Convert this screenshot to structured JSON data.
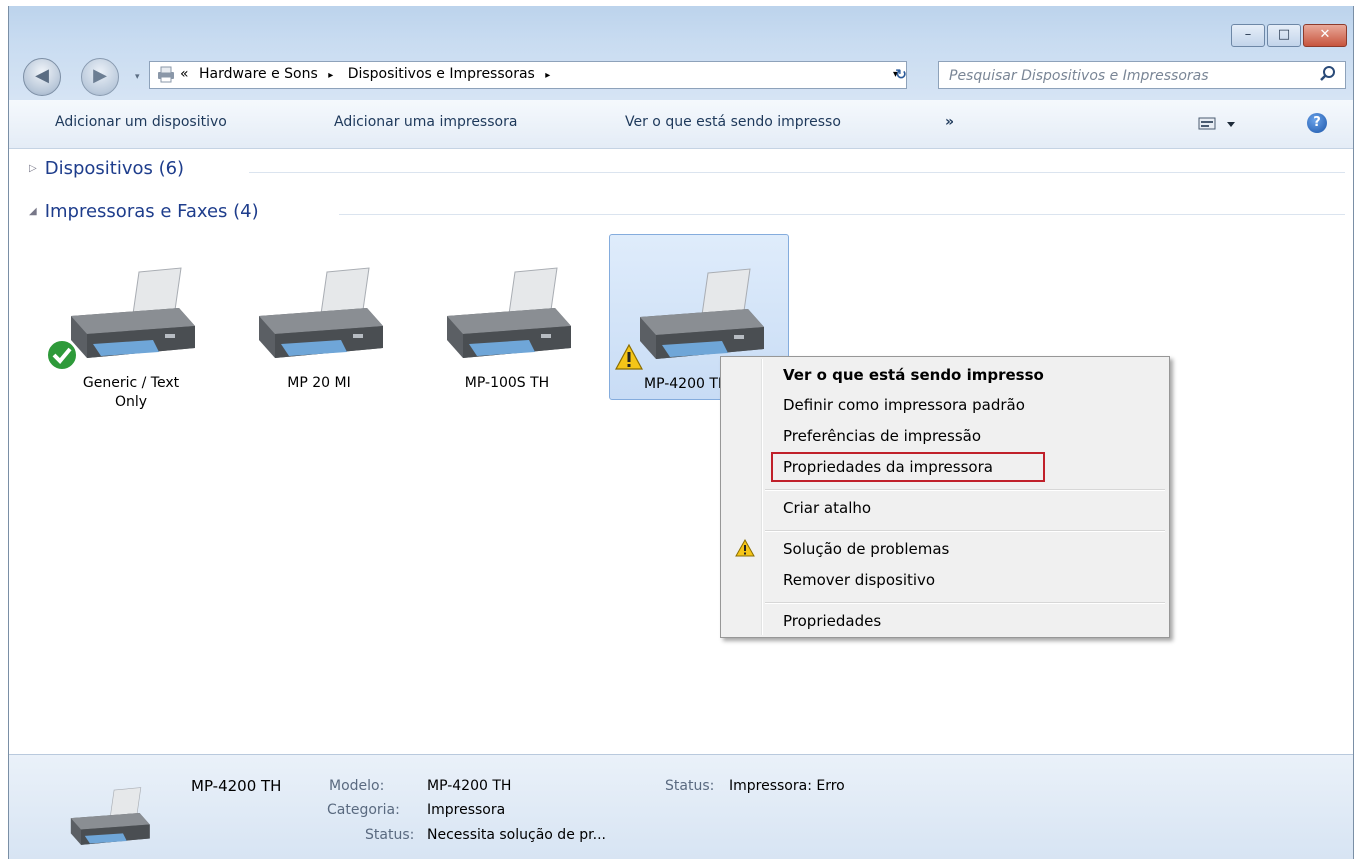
{
  "window": {
    "controls": {
      "minimize": "–",
      "maximize": "□",
      "close": "✕"
    }
  },
  "nav": {
    "back": "◀",
    "forward": "▶"
  },
  "address": {
    "prefix": "«",
    "crumbs": [
      "Hardware e Sons",
      "Dispositivos e Impressoras"
    ],
    "separator": "▸",
    "dropdown": "▾"
  },
  "refresh": "↻",
  "search": {
    "placeholder": "Pesquisar Dispositivos e Impressoras"
  },
  "toolbar": {
    "items": [
      "Adicionar um dispositivo",
      "Adicionar uma impressora",
      "Ver o que está sendo impresso",
      "»"
    ],
    "help": "?"
  },
  "groups": {
    "devices": {
      "title": "Dispositivos (6)",
      "arrow": "▷"
    },
    "printers": {
      "title": "Impressoras e Faxes (4)",
      "arrow": "◢"
    }
  },
  "printers": [
    {
      "label": "Generic / Text Only",
      "status": "default"
    },
    {
      "label": "MP 20 MI",
      "status": "none"
    },
    {
      "label": "MP-100S TH",
      "status": "none"
    },
    {
      "label": "MP-4200 TH",
      "status": "warning",
      "selected": true
    }
  ],
  "context_menu": {
    "items": [
      "Ver o que está sendo impresso",
      "Definir como impressora padrão",
      "Preferências de impressão",
      "Propriedades da impressora",
      "Criar atalho",
      "Solução de problemas",
      "Remover dispositivo",
      "Propriedades"
    ],
    "highlighted": "Propriedades da impressora",
    "highlight_color": "#c0202a"
  },
  "details": {
    "name": "MP-4200 TH",
    "model_label": "Modelo:",
    "model": "MP-4200 TH",
    "category_label": "Categoria:",
    "category": "Impressora",
    "status_label": "Status:",
    "status": "Necessita solução de pr...",
    "printer_status_label": "Status:",
    "printer_status": "Impressora: Erro"
  },
  "colors": {
    "group_header": "#1e3d8c",
    "toolbar_text": "#1e395b",
    "selection": "#c8dcf5"
  }
}
